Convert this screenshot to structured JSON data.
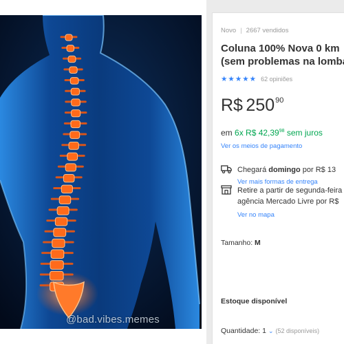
{
  "image": {
    "alt": "X-ray style illustration of a human back with an orange spine",
    "watermark": "@bad.vibes.memes"
  },
  "listing": {
    "condition": "Novo",
    "sold": "2667 vendidos",
    "title_line1": "Coluna 100% Nova 0 km",
    "title_line2": "(sem problemas na lombar)",
    "stars": "★★★★★",
    "reviews": "62 opiniões",
    "price_currency": "R$",
    "price_integer": "250",
    "price_cents": "90",
    "installments_prefix": "em ",
    "installments_main": "6x R$ 42,39",
    "installments_cents": "98",
    "installments_suffix": " sem juros",
    "payment_link": "Ver os meios de pagamento"
  },
  "shipping": {
    "delivery_prefix": "Chegará ",
    "delivery_day": "domingo",
    "delivery_suffix": " por R$ 13",
    "delivery_link": "Ver mais formas de entrega",
    "pickup_line1": "Retire a partir de segunda-feira",
    "pickup_line2": "agência Mercado Livre por R$",
    "pickup_link": "Ver no mapa"
  },
  "variation": {
    "size_label": "Tamanho: ",
    "size_value": "M"
  },
  "stock": {
    "label": "Estoque disponível",
    "quantity_label": "Quantidade: ",
    "quantity_value": "1",
    "available": "(52 disponíveis)"
  },
  "colors": {
    "link_blue": "#3483fa",
    "price_green": "#00a650",
    "spine_orange": "#ff6a1a",
    "xray_blue": "#1e7ad8"
  },
  "icons": [
    "star-icon",
    "truck-icon",
    "store-icon",
    "chevron-down-icon"
  ]
}
